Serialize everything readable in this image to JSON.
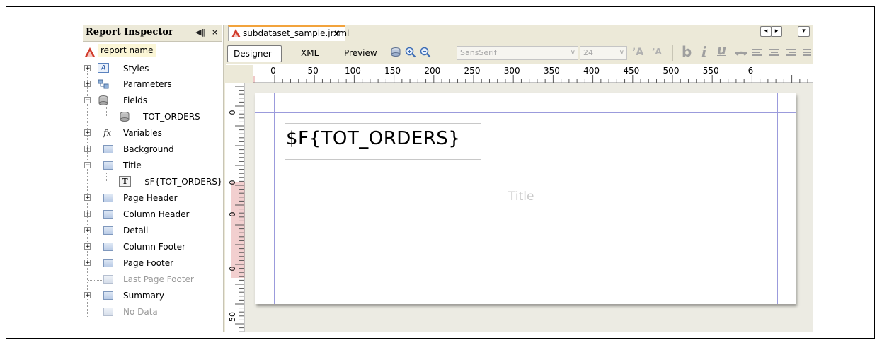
{
  "inspector": {
    "title": "Report Inspector",
    "minimize_label": "◀‖",
    "close_label": "×",
    "items": [
      {
        "label": "report name"
      },
      {
        "label": "Styles"
      },
      {
        "label": "Parameters"
      },
      {
        "label": "Fields"
      },
      {
        "label": "TOT_ORDERS"
      },
      {
        "label": "Variables"
      },
      {
        "label": "Background"
      },
      {
        "label": "Title"
      },
      {
        "label": "$F{TOT_ORDERS}"
      },
      {
        "label": "Page Header"
      },
      {
        "label": "Column Header"
      },
      {
        "label": "Detail"
      },
      {
        "label": "Column Footer"
      },
      {
        "label": "Page Footer"
      },
      {
        "label": "Last Page Footer"
      },
      {
        "label": "Summary"
      },
      {
        "label": "No Data"
      }
    ],
    "variables_glyph": "fx",
    "text_field_glyph": "T"
  },
  "editor": {
    "file_tab": "subdataset_sample.jrxml",
    "file_tab_close": "×",
    "modes": [
      "Designer",
      "XML",
      "Preview"
    ],
    "font_name": "SansSerif",
    "font_size": "24",
    "bold_glyph": "b",
    "italic_glyph": "i",
    "underline_glyph": "u"
  },
  "ruler": {
    "h_ticks": [
      "0",
      "50",
      "100",
      "150",
      "200",
      "250",
      "300",
      "350",
      "400",
      "450",
      "500",
      "550",
      "6"
    ],
    "v_ticks": [
      "0",
      "0",
      "0",
      "0",
      "50"
    ]
  },
  "canvas": {
    "field_expression": "$F{TOT_ORDERS}",
    "band_label": "Title"
  },
  "colors": {
    "panel": "#ece9d8",
    "guide": "#9b9bdc",
    "tab_accent": "#f2a33c"
  }
}
